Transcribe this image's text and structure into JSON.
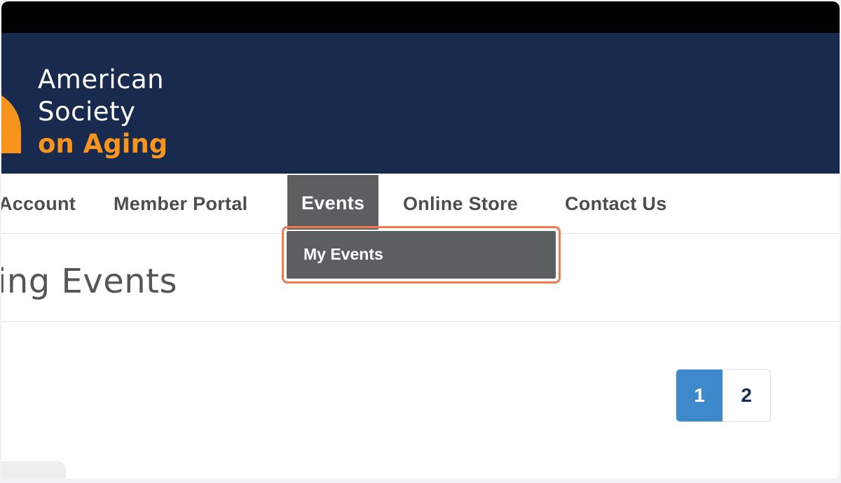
{
  "header": {
    "logo_lines": [
      "American",
      "Society",
      "on Aging"
    ]
  },
  "nav": {
    "items": [
      {
        "label": "Account"
      },
      {
        "label": "Member Portal"
      },
      {
        "label": "Events"
      },
      {
        "label": "Online Store"
      },
      {
        "label": "Contact Us"
      }
    ],
    "active": "Events"
  },
  "dropdown": {
    "items": [
      {
        "label": "My Events"
      }
    ]
  },
  "page": {
    "title": "ing Events"
  },
  "pagination": {
    "pages": [
      "1",
      "2"
    ],
    "current": "1"
  },
  "colors": {
    "header_bg": "#182a4e",
    "brand_orange": "#f7941d",
    "nav_active_bg": "#5c5e60",
    "highlight_border": "#f07b4f",
    "page_current_bg": "#3e88cc"
  }
}
